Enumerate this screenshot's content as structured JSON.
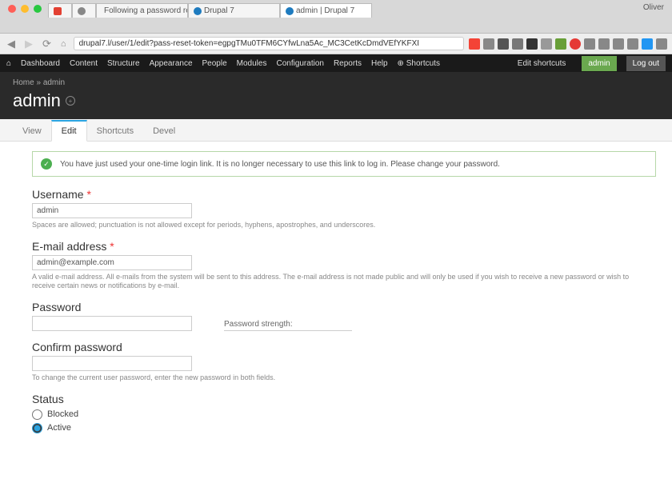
{
  "browser": {
    "user_label": "Oliver",
    "tabs": [
      {
        "label": ""
      },
      {
        "label": ""
      },
      {
        "label": "Following a password res…"
      },
      {
        "label": "Drupal 7"
      },
      {
        "label": "admin | Drupal 7"
      }
    ],
    "url": "drupal7.l/user/1/edit?pass-reset-token=egpgTMu0TFM6CYfwLna5Ac_MC3CetKcDmdVEfYKFXI"
  },
  "toolbar": {
    "items": [
      "Dashboard",
      "Content",
      "Structure",
      "Appearance",
      "People",
      "Modules",
      "Configuration",
      "Reports",
      "Help"
    ],
    "shortcuts_label": "Shortcuts",
    "edit_shortcuts": "Edit shortcuts",
    "admin_btn": "admin",
    "logout_btn": "Log out"
  },
  "header": {
    "breadcrumb_home": "Home",
    "breadcrumb_sep": "»",
    "breadcrumb_current": "admin",
    "title": "admin"
  },
  "local_tabs": {
    "view": "View",
    "edit": "Edit",
    "shortcuts": "Shortcuts",
    "devel": "Devel"
  },
  "status": {
    "msg": "You have just used your one-time login link. It is no longer necessary to use this link to log in. Please change your password."
  },
  "form": {
    "username_label": "Username",
    "username_value": "admin",
    "username_desc": "Spaces are allowed; punctuation is not allowed except for periods, hyphens, apostrophes, and underscores.",
    "email_label": "E-mail address",
    "email_value": "admin@example.com",
    "email_desc": "A valid e-mail address. All e-mails from the system will be sent to this address. The e-mail address is not made public and will only be used if you wish to receive a new password or wish to receive certain news or notifications by e-mail.",
    "password_label": "Password",
    "password_strength_label": "Password strength:",
    "confirm_label": "Confirm password",
    "confirm_desc": "To change the current user password, enter the new password in both fields.",
    "status_legend": "Status",
    "status_blocked": "Blocked",
    "status_active": "Active"
  }
}
